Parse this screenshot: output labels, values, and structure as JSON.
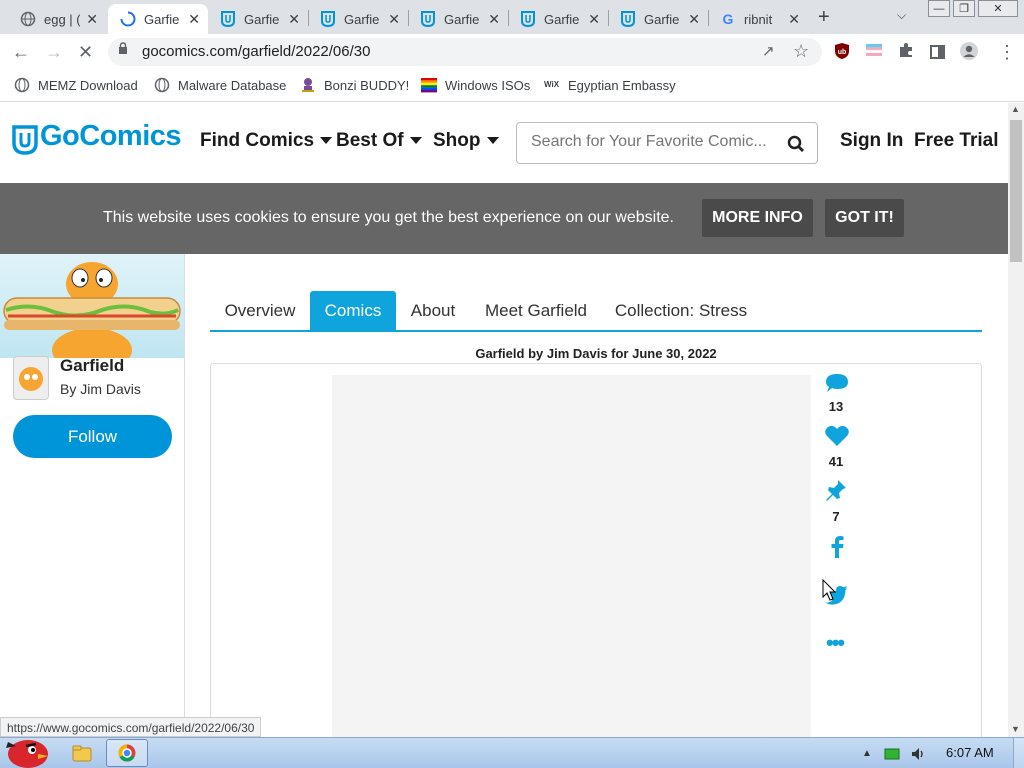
{
  "browser": {
    "tabs": [
      {
        "label": "egg | (",
        "icon": "globe-icon"
      },
      {
        "label": "Garfie",
        "icon": "loading-icon",
        "active": true
      },
      {
        "label": "Garfie",
        "icon": "gocomics-icon"
      },
      {
        "label": "Garfie",
        "icon": "gocomics-icon"
      },
      {
        "label": "Garfie",
        "icon": "gocomics-icon"
      },
      {
        "label": "Garfie",
        "icon": "gocomics-icon"
      },
      {
        "label": "Garfie",
        "icon": "gocomics-icon"
      },
      {
        "label": "ribnit",
        "icon": "google-icon"
      }
    ],
    "url": "gocomics.com/garfield/2022/06/30",
    "bookmarks": [
      {
        "label": "MEMZ Download",
        "icon": "globe-icon"
      },
      {
        "label": "Malware Database",
        "icon": "globe-icon"
      },
      {
        "label": "Bonzi BUDDY!",
        "icon": "bonzi-icon"
      },
      {
        "label": "Windows ISOs",
        "icon": "rainbow-flag-icon"
      },
      {
        "label": "Egyptian Embassy",
        "icon": "wix-icon"
      }
    ],
    "status_url": "https://www.gocomics.com/garfield/2022/06/30"
  },
  "site": {
    "logo": "GoComics",
    "nav": [
      "Find Comics",
      "Best Of",
      "Shop"
    ],
    "search_placeholder": "Search for Your Favorite Comic...",
    "sign_in": "Sign In",
    "free_trial": "Free Trial",
    "accent": "#0095d8"
  },
  "cookie": {
    "message": "This website uses cookies to ensure you get the best experience on our website.",
    "more_info": "MORE INFO",
    "got_it": "GOT IT!"
  },
  "feature": {
    "title": "Garfield",
    "author": "By Jim Davis",
    "follow": "Follow"
  },
  "comic_tabs": [
    "Overview",
    "Comics",
    "About",
    "Meet Garfield",
    "Collection: Stress"
  ],
  "strip": {
    "title": "Garfield by Jim Davis for June 30, 2022",
    "comments": "13",
    "likes": "41",
    "pins": "7"
  },
  "taskbar": {
    "time": "6:07 AM"
  }
}
